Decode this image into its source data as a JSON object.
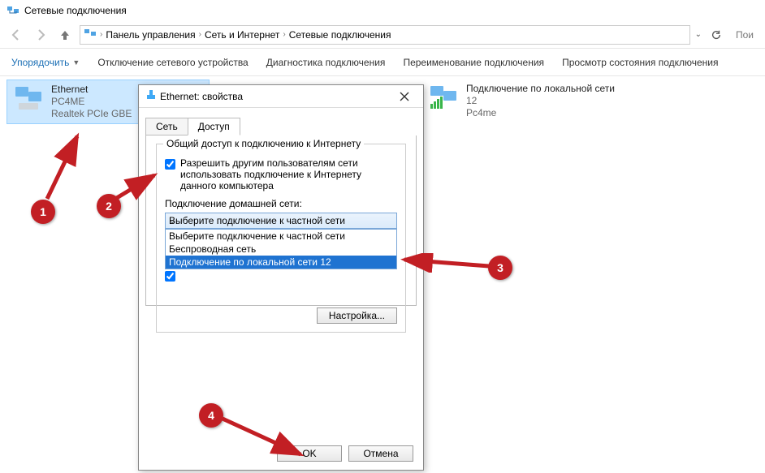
{
  "window": {
    "title": "Сетевые подключения"
  },
  "breadcrumb": {
    "root": "Панель управления",
    "mid": "Сеть и Интернет",
    "leaf": "Сетевые подключения"
  },
  "address": {
    "search_hint": "Пои"
  },
  "toolbar": {
    "organize": "Упорядочить",
    "disable": "Отключение сетевого устройства",
    "diagnose": "Диагностика подключения",
    "rename": "Переименование подключения",
    "status": "Просмотр состояния подключения"
  },
  "connections": {
    "ethernet": {
      "name": "Ethernet",
      "line2": "PC4ME",
      "line3": "Realtek PCIe GBE"
    },
    "lan12": {
      "name": "Подключение по локальной сети",
      "line2": "12",
      "line3": "Pc4me"
    }
  },
  "dialog": {
    "title": "Ethernet: свойства",
    "tab_network": "Сеть",
    "tab_access": "Доступ",
    "group_title": "Общий доступ к подключению к Интернету",
    "chk_allow": "Разрешить другим пользователям сети использовать подключение к Интернету данного компьютера",
    "homenet_label": "Подключение домашней сети:",
    "combo_selected": "Выберите подключение к частной сети",
    "combo_opts": {
      "0": "Выберите подключение к частной сети",
      "1": "Беспроводная сеть",
      "2": "Подключение по локальной сети 12"
    },
    "configure": "Настройка...",
    "ok": "OK",
    "cancel": "Отмена"
  },
  "markers": {
    "m1": "1",
    "m2": "2",
    "m3": "3",
    "m4": "4"
  }
}
